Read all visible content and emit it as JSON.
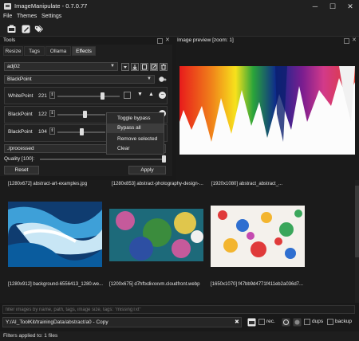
{
  "window": {
    "title": "ImageManipulate - 0.7.0.77",
    "minimize": "─",
    "maximize": "☐",
    "close": "✕"
  },
  "menu": {
    "file": "File",
    "themes": "Themes",
    "settings": "Settings"
  },
  "tools_panel": {
    "title": "Tools",
    "tabs": [
      "Resize",
      "Tags",
      "Ollama",
      "Effects"
    ],
    "active_tab": "Effects",
    "preset": "adj02",
    "effect_select": "BlackPoint",
    "effects": [
      {
        "name": "WhitePoint",
        "value": "221"
      },
      {
        "name": "BlackPoint",
        "value": "122"
      },
      {
        "name": "BlackPoint",
        "value": "104"
      }
    ],
    "output_path": "./processed",
    "quality_label": "Quality [100]:",
    "reset_label": "Reset",
    "apply_label": "Apply"
  },
  "context_menu": {
    "items": [
      "Toggle bypass",
      "Bypass all",
      "Remove selected",
      "Clear"
    ],
    "highlighted": "Bypass all"
  },
  "preview_panel": {
    "title": "Image preview [zoom: 1]"
  },
  "gallery": {
    "top_captions": [
      "[1280x672] abstract-art-examples.jpg",
      "[1280x853] abstract-photography-design-...",
      "[1920x1080] abstract_abstract_..."
    ],
    "items": [
      {
        "caption": "[1280x912] background-6556413_1280.we...",
        "colors": [
          "#0a5c9e",
          "#3ea0d8",
          "#c8e6f5",
          "#ffffff",
          "#0f3c70"
        ]
      },
      {
        "caption": "[1200x675] d7hftxdivxxvm.cloudfront.webp",
        "colors": [
          "#1d6a7a",
          "#c55a9b",
          "#3b8c3d",
          "#e0c64c",
          "#2d4fa3"
        ]
      },
      {
        "caption": "[1650x1070] f47bb9d4771f411eb2a036d7...",
        "colors": [
          "#f4f1ec",
          "#e03a3a",
          "#2f6fd0",
          "#f3b52f",
          "#3aa65b"
        ]
      }
    ]
  },
  "filter": {
    "placeholder": "filter images by name, path, tags, image size, tags: \"missingTxt\""
  },
  "path_bar": {
    "value": "Y:/AI_ToolKit/trainingData/abstract/a0 - Copy",
    "clear": "✖",
    "rec_label": "rec.",
    "dups_label": "dups",
    "backup_label": "backup"
  },
  "status": {
    "text": "Filters applied to: 1 files"
  },
  "colors": {
    "background": "#191919",
    "panel": "#1e1e1e",
    "accent": "#4a90d9",
    "highlight": "#3d3d3d"
  }
}
